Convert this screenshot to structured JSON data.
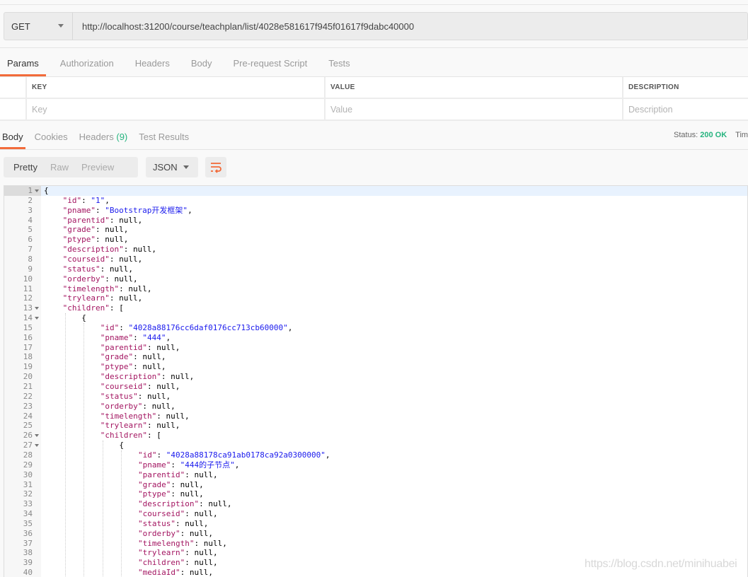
{
  "request": {
    "method": "GET",
    "url": "http://localhost:31200/course/teachplan/list/4028e581617f945f01617f9dabc40000"
  },
  "request_tabs": [
    "Params",
    "Authorization",
    "Headers",
    "Body",
    "Pre-request Script",
    "Tests"
  ],
  "params": {
    "headers": [
      "KEY",
      "VALUE",
      "DESCRIPTION"
    ],
    "placeholders": [
      "Key",
      "Value",
      "Description"
    ]
  },
  "response_tabs": [
    {
      "label": "Body"
    },
    {
      "label": "Cookies"
    },
    {
      "label": "Headers",
      "count": "(9)"
    },
    {
      "label": "Test Results"
    }
  ],
  "status": {
    "label": "Status:",
    "value": "200 OK",
    "time_label": "Tim"
  },
  "format": {
    "modes": [
      "Pretty",
      "Raw",
      "Preview"
    ],
    "type": "JSON"
  },
  "colors": {
    "accent": "#f26b3a",
    "ok": "#26b47f",
    "key": "#a31561",
    "string": "#1a1aed"
  },
  "code_lines": [
    {
      "i": 0,
      "t": "{",
      "f": 1
    },
    {
      "i": 1,
      "k": "id",
      "s": "1"
    },
    {
      "i": 1,
      "k": "pname",
      "s": "Bootstrap开发框架"
    },
    {
      "i": 1,
      "k": "parentid",
      "v": "null"
    },
    {
      "i": 1,
      "k": "grade",
      "v": "null"
    },
    {
      "i": 1,
      "k": "ptype",
      "v": "null"
    },
    {
      "i": 1,
      "k": "description",
      "v": "null"
    },
    {
      "i": 1,
      "k": "courseid",
      "v": "null"
    },
    {
      "i": 1,
      "k": "status",
      "v": "null"
    },
    {
      "i": 1,
      "k": "orderby",
      "v": "null"
    },
    {
      "i": 1,
      "k": "timelength",
      "v": "null"
    },
    {
      "i": 1,
      "k": "trylearn",
      "v": "null"
    },
    {
      "i": 1,
      "k": "children",
      "v": "[",
      "f": 1
    },
    {
      "i": 2,
      "t": "{",
      "f": 1
    },
    {
      "i": 3,
      "k": "id",
      "s": "4028a88176cc6daf0176cc713cb60000"
    },
    {
      "i": 3,
      "k": "pname",
      "s": "444"
    },
    {
      "i": 3,
      "k": "parentid",
      "v": "null"
    },
    {
      "i": 3,
      "k": "grade",
      "v": "null"
    },
    {
      "i": 3,
      "k": "ptype",
      "v": "null"
    },
    {
      "i": 3,
      "k": "description",
      "v": "null"
    },
    {
      "i": 3,
      "k": "courseid",
      "v": "null"
    },
    {
      "i": 3,
      "k": "status",
      "v": "null"
    },
    {
      "i": 3,
      "k": "orderby",
      "v": "null"
    },
    {
      "i": 3,
      "k": "timelength",
      "v": "null"
    },
    {
      "i": 3,
      "k": "trylearn",
      "v": "null"
    },
    {
      "i": 3,
      "k": "children",
      "v": "[",
      "f": 1
    },
    {
      "i": 4,
      "t": "{",
      "f": 1
    },
    {
      "i": 5,
      "k": "id",
      "s": "4028a88178ca91ab0178ca92a0300000"
    },
    {
      "i": 5,
      "k": "pname",
      "s": "444的子节点"
    },
    {
      "i": 5,
      "k": "parentid",
      "v": "null"
    },
    {
      "i": 5,
      "k": "grade",
      "v": "null"
    },
    {
      "i": 5,
      "k": "ptype",
      "v": "null"
    },
    {
      "i": 5,
      "k": "description",
      "v": "null"
    },
    {
      "i": 5,
      "k": "courseid",
      "v": "null"
    },
    {
      "i": 5,
      "k": "status",
      "v": "null"
    },
    {
      "i": 5,
      "k": "orderby",
      "v": "null"
    },
    {
      "i": 5,
      "k": "timelength",
      "v": "null"
    },
    {
      "i": 5,
      "k": "trylearn",
      "v": "null"
    },
    {
      "i": 5,
      "k": "children",
      "v": "null"
    },
    {
      "i": 5,
      "k": "mediaId",
      "v": "null"
    }
  ],
  "watermark": "https://blog.csdn.net/minihuabei"
}
